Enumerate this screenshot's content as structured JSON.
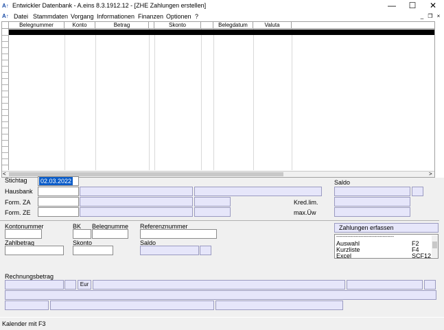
{
  "window": {
    "title": "Entwickler Datenbank - A.eins 8.3.1912.12 - [ZHE Zahlungen erstellen]",
    "logo_text": "A↑",
    "minimize_glyph": "—",
    "maximize_glyph": "☐",
    "close_glyph": "✕"
  },
  "menu": {
    "items": [
      "Datei",
      "Stammdaten",
      "Vorgang",
      "Informationen",
      "Finanzen",
      "Optionen",
      "?"
    ],
    "mdi_minimize": "_",
    "mdi_restore": "❐",
    "mdi_close": "×"
  },
  "grid": {
    "columns": [
      "Belegnummer",
      "Konto",
      "Betrag",
      "",
      "Skonto",
      "",
      "Belegdatum",
      "Valuta",
      ""
    ],
    "scroll_left": "<",
    "scroll_right": ">"
  },
  "form": {
    "stichtag_label": "Stichtag",
    "stichtag_value": "02.03.2022",
    "hausbank_label": "Hausbank",
    "form_za_label": "Form. ZA",
    "form_ze_label": "Form. ZE",
    "saldo_label": "Saldo",
    "kredlim_label": "Kred.lim.",
    "maxuew_label": "max.Üw",
    "kontonummer_label": "Kontonummer",
    "bk_label": "BK",
    "belegnummer_label": "Belegnumme",
    "referenznummer_label": "Referenznummer",
    "zahlbetrag_label": "Zahlbetrag",
    "skonto_label": "Skonto",
    "saldo2_label": "Saldo",
    "zahlungen_button": "Zahlungen erfassen",
    "list_separator": "------------------------------------",
    "list_items": [
      {
        "name": "Auswahl",
        "key": "F2"
      },
      {
        "name": "Kurzliste",
        "key": "F4"
      },
      {
        "name": "Excel",
        "key": "SCF12"
      }
    ],
    "rechnungsbetrag_label": "Rechnungsbetrag",
    "currency": "Eur"
  },
  "status": {
    "text": "Kalender mit F3"
  }
}
